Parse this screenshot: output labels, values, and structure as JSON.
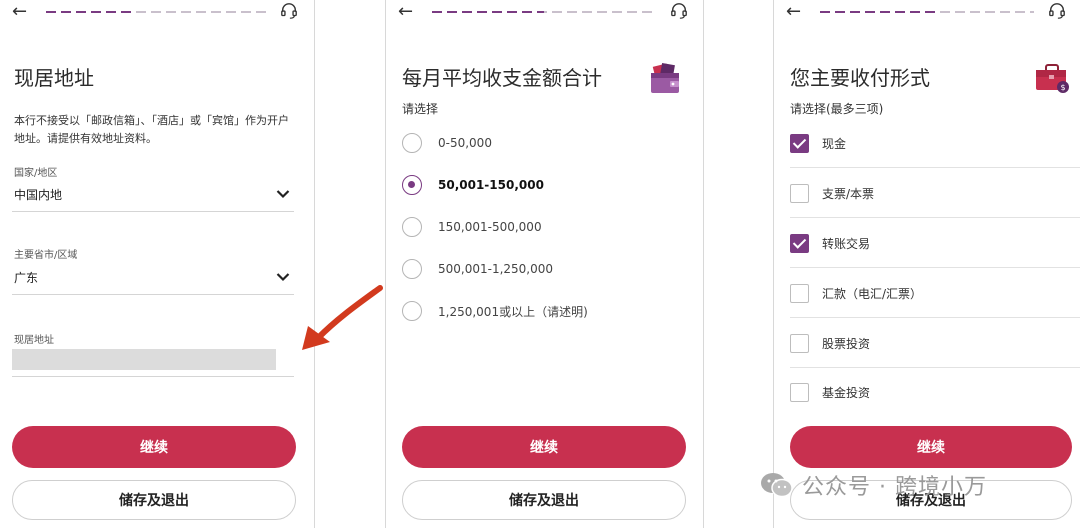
{
  "colors": {
    "accent": "#7a3b82",
    "primary_button": "#c8304f",
    "arrow": "#d23a1e"
  },
  "screen1": {
    "title": "现居地址",
    "notice": "本行不接受以「邮政信箱」、「酒店」或「宾馆」作为开户地址。请提供有效地址资料。",
    "fields": [
      {
        "label": "国家/地区",
        "value": "中国内地"
      },
      {
        "label": "主要省市/区域",
        "value": "广东"
      },
      {
        "label": "现居地址",
        "value": ""
      }
    ],
    "continue_label": "继续",
    "save_exit_label": "储存及退出"
  },
  "screen2": {
    "title": "每月平均收支金额合计",
    "subtitle": "请选择",
    "options": [
      {
        "label": "0-50,000",
        "selected": false
      },
      {
        "label": "50,001-150,000",
        "selected": true
      },
      {
        "label": "150,001-500,000",
        "selected": false
      },
      {
        "label": "500,001-1,250,000",
        "selected": false
      },
      {
        "label": "1,250,001或以上（请述明)",
        "selected": false
      }
    ],
    "continue_label": "继续",
    "save_exit_label": "储存及退出"
  },
  "screen3": {
    "title": "您主要收付形式",
    "subtitle": "请选择(最多三项)",
    "options": [
      {
        "label": "现金",
        "checked": true
      },
      {
        "label": "支票/本票",
        "checked": false
      },
      {
        "label": "转账交易",
        "checked": true
      },
      {
        "label": "汇款（电汇/汇票）",
        "checked": false
      },
      {
        "label": "股票投资",
        "checked": false
      },
      {
        "label": "基金投资",
        "checked": false
      }
    ],
    "continue_label": "继续",
    "save_exit_label": "储存及退出"
  },
  "watermark": {
    "text": "公众号 · 跨境小万"
  },
  "icons": {
    "back": "back-arrow-icon",
    "support": "headset-icon",
    "dropdown": "chevron-down-icon",
    "wallet": "wallet-icon",
    "briefcase": "briefcase-icon"
  }
}
